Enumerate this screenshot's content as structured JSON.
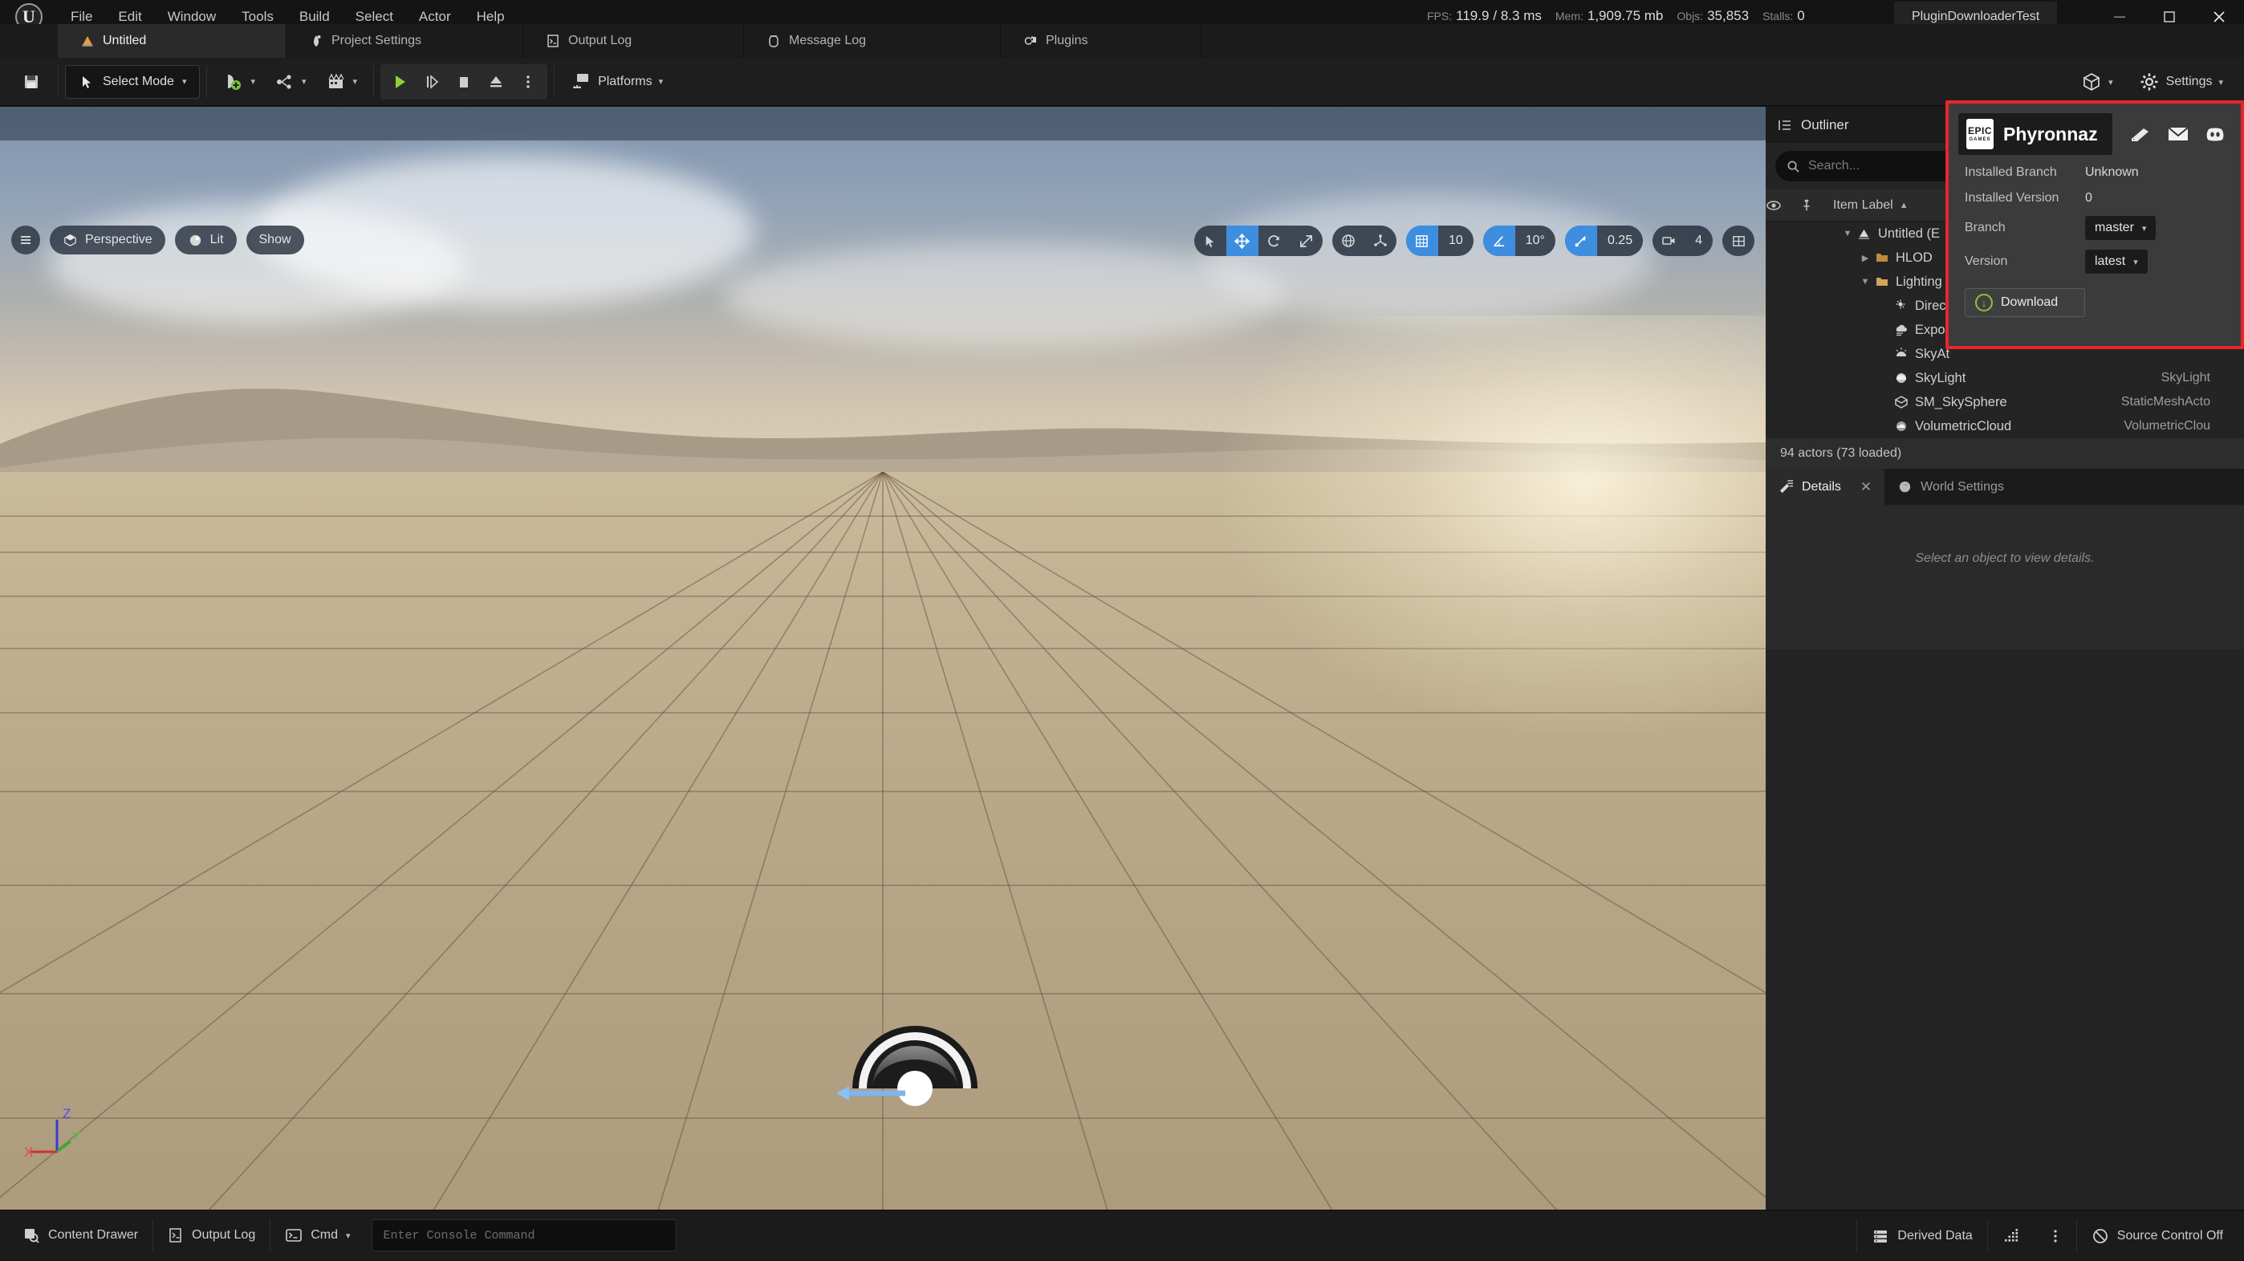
{
  "app": {
    "project_tab_title": "PluginDownloaderTest",
    "logo_letter": "U"
  },
  "menu": {
    "items": [
      {
        "label": "File"
      },
      {
        "label": "Edit"
      },
      {
        "label": "Window"
      },
      {
        "label": "Tools"
      },
      {
        "label": "Build"
      },
      {
        "label": "Select"
      },
      {
        "label": "Actor"
      },
      {
        "label": "Help"
      }
    ]
  },
  "stats": {
    "fps_label": "FPS:",
    "fps_value": "119.9",
    "frametime": "/ 8.3 ms",
    "mem_label": "Mem:",
    "mem_value": "1,909.75 mb",
    "objs_label": "Objs:",
    "objs_value": "35,853",
    "stalls_label": "Stalls:",
    "stalls_value": "0"
  },
  "window_controls": {
    "minimize": "—",
    "maximize": "□",
    "close": "✕"
  },
  "tabs": [
    {
      "label": "Untitled",
      "icon": "level-icon",
      "active": true
    },
    {
      "label": "Project Settings",
      "icon": "settings-icon",
      "active": false
    },
    {
      "label": "Output Log",
      "icon": "log-icon",
      "active": false
    },
    {
      "label": "Message Log",
      "icon": "message-icon",
      "active": false
    },
    {
      "label": "Plugins",
      "icon": "plugin-icon",
      "active": false
    }
  ],
  "toolbar": {
    "save_icon": "save-icon",
    "select_mode": "Select Mode",
    "add_icon": "add-actor-icon",
    "blueprint_icon": "blueprints-icon",
    "cinematics_icon": "cinematics-icon",
    "play_icon": "play-icon",
    "skip_icon": "skip-icon",
    "stop_icon": "stop-icon",
    "eject_icon": "eject-icon",
    "more_icon": "more-options-icon",
    "platforms": "Platforms",
    "box_icon": "content-box-icon",
    "settings": "Settings"
  },
  "viewport": {
    "menu_icon": "viewport-menu-icon",
    "perspective": "Perspective",
    "lit": "Lit",
    "show": "Show",
    "transform": {
      "select_icon": "cursor-select-icon",
      "move_icon": "move-translate-icon",
      "rotate_icon": "rotate-icon",
      "scale_icon": "scale-icon",
      "active": "move"
    },
    "coord_world_icon": "world-coordinate-icon",
    "coord_local_icon": "local-coordinate-icon",
    "grid_snap_icon": "grid-snap-icon",
    "grid_snap_value": "10",
    "angle_snap_icon": "angle-snap-icon",
    "angle_snap_value": "10°",
    "scale_snap_icon": "scale-snap-icon",
    "scale_snap_value": "0.25",
    "camera_speed_icon": "camera-speed-icon",
    "camera_speed_value": "4",
    "layout_icon": "viewport-layout-icon",
    "axis_z": "Z",
    "axis_y": "Y",
    "axis_x": "X"
  },
  "outliner": {
    "title": "Outliner",
    "close": "✕",
    "search_placeholder": "Search...",
    "search_value": "",
    "column_item_label": "Item Label",
    "sort_arrow": "▲",
    "eye_icon": "visibility-eye-icon",
    "pin_icon": "pin-icon",
    "rows": [
      {
        "label": "Untitled (E",
        "type": "",
        "depth": 1,
        "twisty": "▼",
        "icon": "level-icon"
      },
      {
        "label": "HLOD",
        "type": "",
        "depth": 2,
        "twisty": "▶",
        "icon": "folder-icon"
      },
      {
        "label": "Lighting",
        "type": "",
        "depth": 2,
        "twisty": "▼",
        "icon": "folder-icon"
      },
      {
        "label": "Direc",
        "type": "",
        "depth": 3,
        "twisty": "",
        "icon": "directional-light-icon"
      },
      {
        "label": "Expon",
        "type": "",
        "depth": 3,
        "twisty": "",
        "icon": "fog-icon"
      },
      {
        "label": "SkyAt",
        "type": "",
        "depth": 3,
        "twisty": "",
        "icon": "sky-atmosphere-icon"
      },
      {
        "label": "SkyLight",
        "type": "SkyLight",
        "depth": 3,
        "twisty": "",
        "icon": "sky-light-icon"
      },
      {
        "label": "SM_SkySphere",
        "type": "StaticMeshActo",
        "depth": 3,
        "twisty": "",
        "icon": "static-mesh-icon"
      },
      {
        "label": "VolumetricCloud",
        "type": "VolumetricClou",
        "depth": 3,
        "twisty": "",
        "icon": "volumetric-cloud-icon"
      }
    ],
    "actor_count": "94 actors (73 loaded)"
  },
  "details": {
    "tab_label": "Details",
    "close": "✕",
    "world_settings_tab": "World Settings",
    "empty_message": "Select an object to view details."
  },
  "plugin_popup": {
    "epic_logo_main": "EPIC",
    "epic_logo_sub": "GAMES",
    "author": "Phyronnaz",
    "icons": [
      {
        "name": "documentation-book-icon"
      },
      {
        "name": "email-envelope-icon"
      },
      {
        "name": "discord-icon"
      }
    ],
    "installed_branch_label": "Installed Branch",
    "installed_branch_value": "Unknown",
    "installed_version_label": "Installed Version",
    "installed_version_value": "0",
    "branch_label": "Branch",
    "branch_value": "master",
    "version_label": "Version",
    "version_value": "latest",
    "download_label": "Download",
    "highlight_color": "#e8262a"
  },
  "statusbar": {
    "content_drawer": "Content Drawer",
    "output_log": "Output Log",
    "cmd_label": "Cmd",
    "console_placeholder": "Enter Console Command",
    "console_value": "",
    "derived_data": "Derived Data",
    "stats_icon": "network-stats-icon",
    "more_icon": "more-vertical-icon",
    "source_control": "Source Control Off"
  }
}
